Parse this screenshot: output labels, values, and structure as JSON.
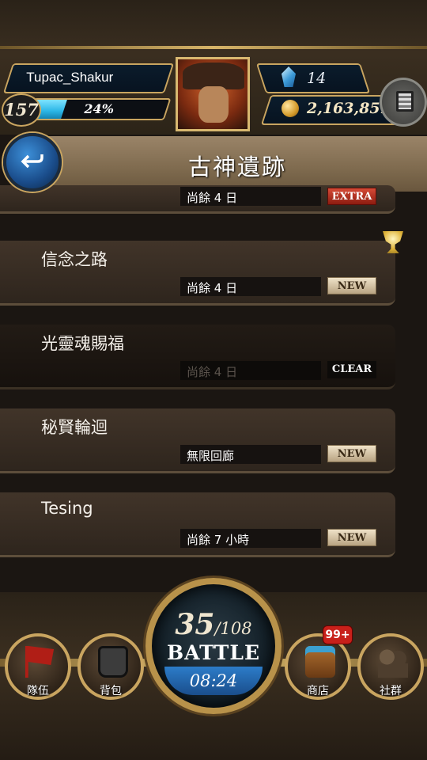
{
  "header": {
    "player_name": "Tupac_Shakur",
    "level": "157",
    "exp_percent_text": "24%",
    "exp_percent": 24,
    "gems": "14",
    "coins": "2,163,851",
    "menu_icon": "menu-book-icon"
  },
  "page": {
    "title": "古神遺跡",
    "back_icon": "back-arrow-icon"
  },
  "list": [
    {
      "title": "",
      "status": "尚餘 4 日",
      "badge": "EXTRA"
    },
    {
      "title": "信念之路",
      "status": "尚餘 4 日",
      "badge": "NEW",
      "trophy": true
    },
    {
      "title": "光靈魂賜福",
      "status": "尚餘 4 日",
      "badge": "CLEAR"
    },
    {
      "title": "秘賢輪迴",
      "status": "無限回廊",
      "badge": "NEW"
    },
    {
      "title": "Tesing",
      "status": "尚餘 7 小時",
      "badge": "NEW"
    }
  ],
  "nav": {
    "team": "隊伍",
    "bag": "背包",
    "shop": "商店",
    "shop_badge": "99+",
    "social": "社群"
  },
  "battle": {
    "stamina_current": "35",
    "stamina_max": "/108",
    "label": "BATTLE",
    "timer": "08:24"
  },
  "colors": {
    "accent_gold": "#c9a560",
    "exp_blue": "#2bb6e6",
    "badge_extra": "#c0392b",
    "badge_new": "#e6d6b8"
  }
}
